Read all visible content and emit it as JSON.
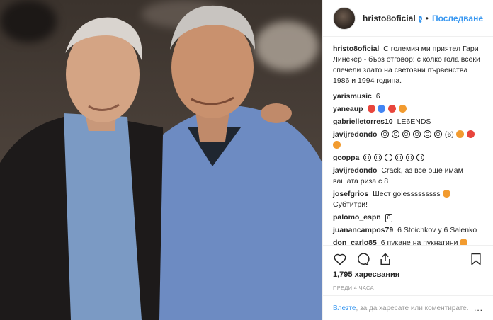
{
  "header": {
    "username": "hristo8oficial",
    "follow_label": "Последване"
  },
  "caption": {
    "username": "hristo8oficial",
    "text": "С големия ми приятел Гари Линекер - бърз отговор: с колко гола всеки спечели злато на световни първенства 1986 и 1994 година."
  },
  "comments": [
    {
      "username": "yarismusic",
      "text": "6"
    },
    {
      "username": "yaneaup",
      "text": ""
    },
    {
      "username": "gabrielletorres10",
      "text": "LE6ENDS"
    },
    {
      "username": "javijredondo",
      "text": "(6)"
    },
    {
      "username": "gcoppa",
      "text": ""
    },
    {
      "username": "javijredondo",
      "text": "Crack, аз все още имам вашата риза с 8"
    },
    {
      "username": "josefgrios",
      "text": "Шест golesssssssss"
    },
    {
      "username": "josefgrios_2",
      "text": "Субтитри!"
    },
    {
      "username": "palomo_espn",
      "text": "6"
    },
    {
      "username": "juanancampos79",
      "text": "6 Stoichkov y 6 Salenko"
    },
    {
      "username": "don_carlo85",
      "text": "6 пукане на пукнатини"
    }
  ],
  "icons": {
    "like": "heart-icon",
    "comment": "comment-icon",
    "share": "share-icon",
    "save": "bookmark-icon"
  },
  "likes": "1,795 харесвания",
  "time": "ПРЕДИ 4 ЧАСА",
  "login": {
    "link": "Влезте",
    "text": ", за да харесате или коментирате.",
    "more": "..."
  },
  "colors": {
    "accent": "#3897f0",
    "text": "#262626",
    "muted": "#999999"
  }
}
